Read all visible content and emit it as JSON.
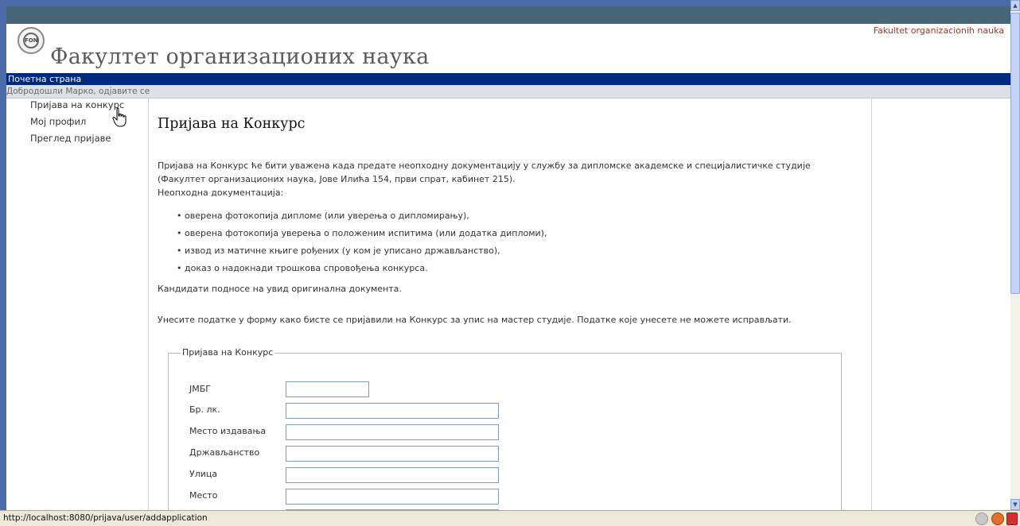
{
  "header": {
    "site_title": "Факултет организационих наука",
    "org_link": "Fakultet organizacionih nauka",
    "logo_text": "FON"
  },
  "nav": {
    "home": "Почетна страна"
  },
  "welcome": "Добродошли Марко, одјавите се",
  "sidebar": {
    "items": [
      {
        "label": "Пријава на конкурс"
      },
      {
        "label": "Мој профил"
      },
      {
        "label": "Преглед пријаве"
      }
    ]
  },
  "main": {
    "heading": "Пријава на Конкурс",
    "intro_line1": "Пријава на Конкурс ће бити уважена када предате неопходну документацију у службу за дипломске академске и специјалистичке студије",
    "intro_line2": "(Факултет организационих наука, Јове Илића 154, први спрат, кабинет 215).",
    "intro_line3": "Неопходна документација:",
    "bullets": [
      "оверена фотокопија дипломе (или уверења о дипломирању),",
      "оверена фотокопија уверења о положеним испитима (или додатка дипломи),",
      "извод из матичне књиге рођених (у ком је уписано држављанство),",
      "доказ о надокнади трошкова спровођења конкурса."
    ],
    "originals_note": "Кандидати подносе на увид оригинална документа.",
    "form_note": "Унесите податке у форму како бисте се пријавили на Конкурс за упис на мастер студије. Податке које унесете не можете исправљати."
  },
  "form": {
    "legend": "Пријава на Конкурс",
    "fields": [
      {
        "label": "ЈМБГ",
        "value": ""
      },
      {
        "label": "Бр. лк.",
        "value": ""
      },
      {
        "label": "Место издавања",
        "value": ""
      },
      {
        "label": "Држављанство",
        "value": ""
      },
      {
        "label": "Улица",
        "value": ""
      },
      {
        "label": "Место",
        "value": ""
      }
    ]
  },
  "status": {
    "url": "http://localhost:8080/prijava/user/addapplication"
  },
  "colors": {
    "nav_bar": "#002a80",
    "top_bar": "#456677",
    "org_link": "#a0362a"
  }
}
